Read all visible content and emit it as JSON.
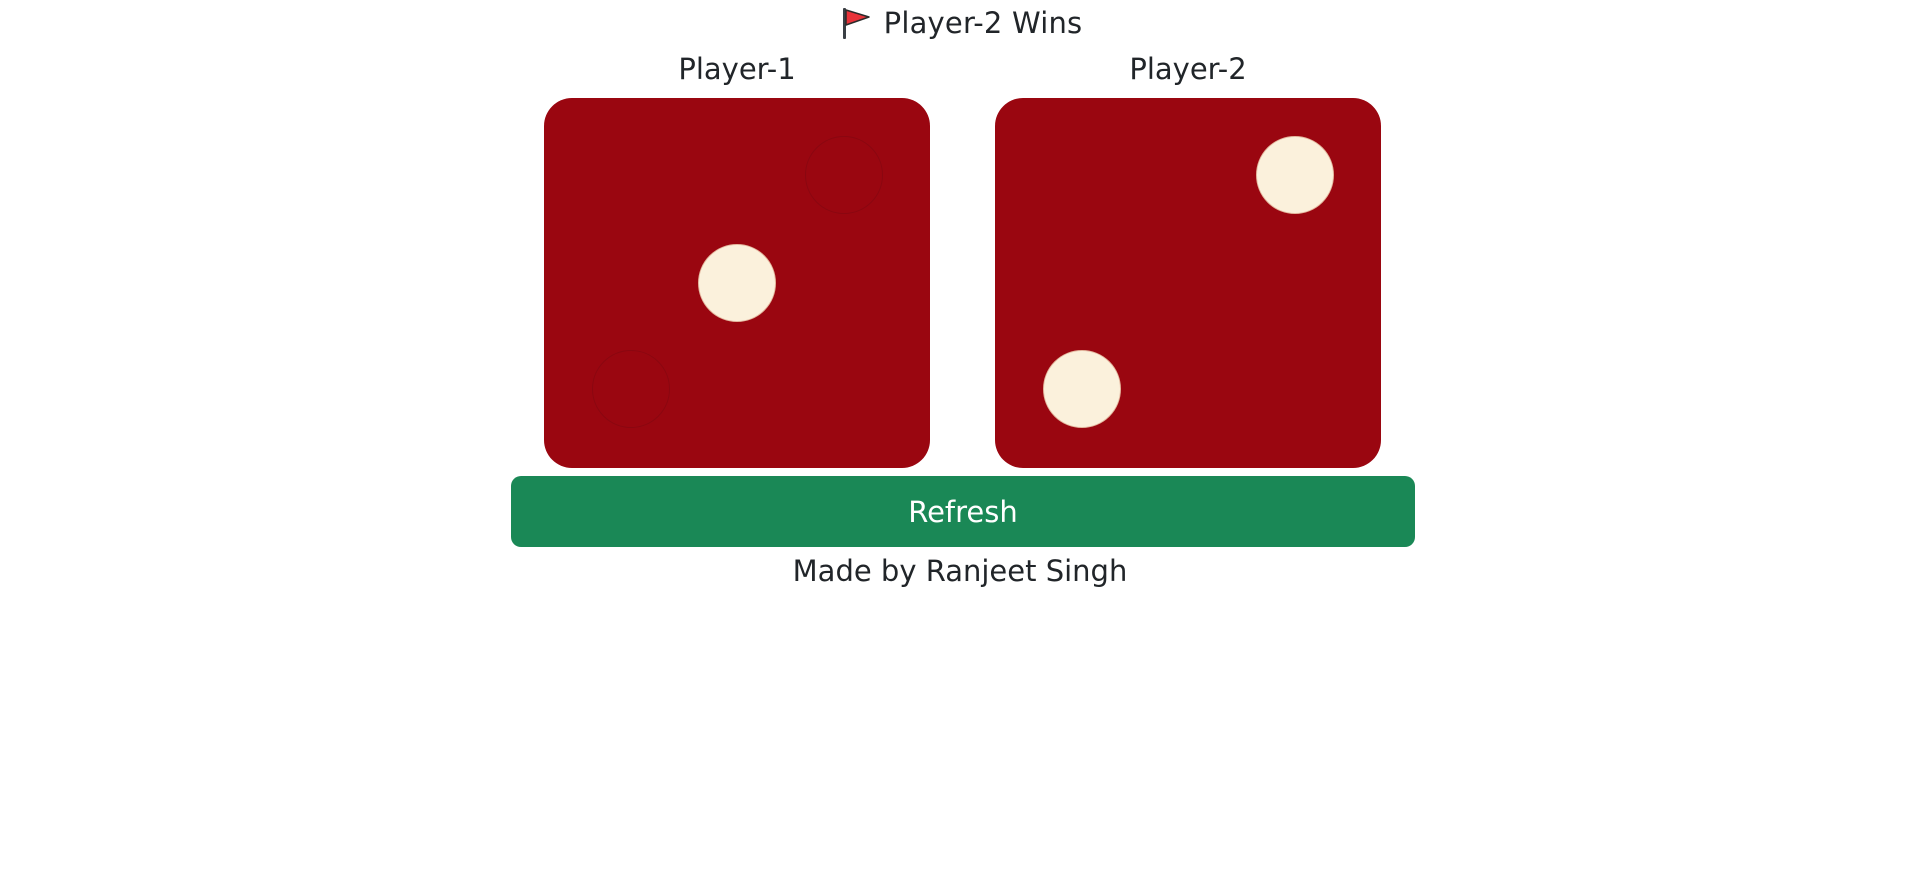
{
  "result": {
    "text": "Player-2 Wins",
    "icon": "red-flag-icon"
  },
  "players": [
    {
      "label": "Player-1",
      "pips": [
        1,
        0,
        1,
        0,
        1
      ]
    },
    {
      "label": "Player-2",
      "pips": [
        0,
        1,
        0,
        1,
        0
      ]
    }
  ],
  "dice": [
    {
      "value": 1,
      "color": "#9a0610"
    },
    {
      "value": 2,
      "color": "#9a0610"
    }
  ],
  "refresh_button": {
    "label": "Refresh",
    "color": "#1a8856"
  },
  "footer": {
    "credit": "Made by Ranjeet Singh"
  },
  "colors": {
    "die": "#9a0610",
    "pip": "#fbf1dc",
    "button": "#1a8856",
    "text": "#212529"
  }
}
